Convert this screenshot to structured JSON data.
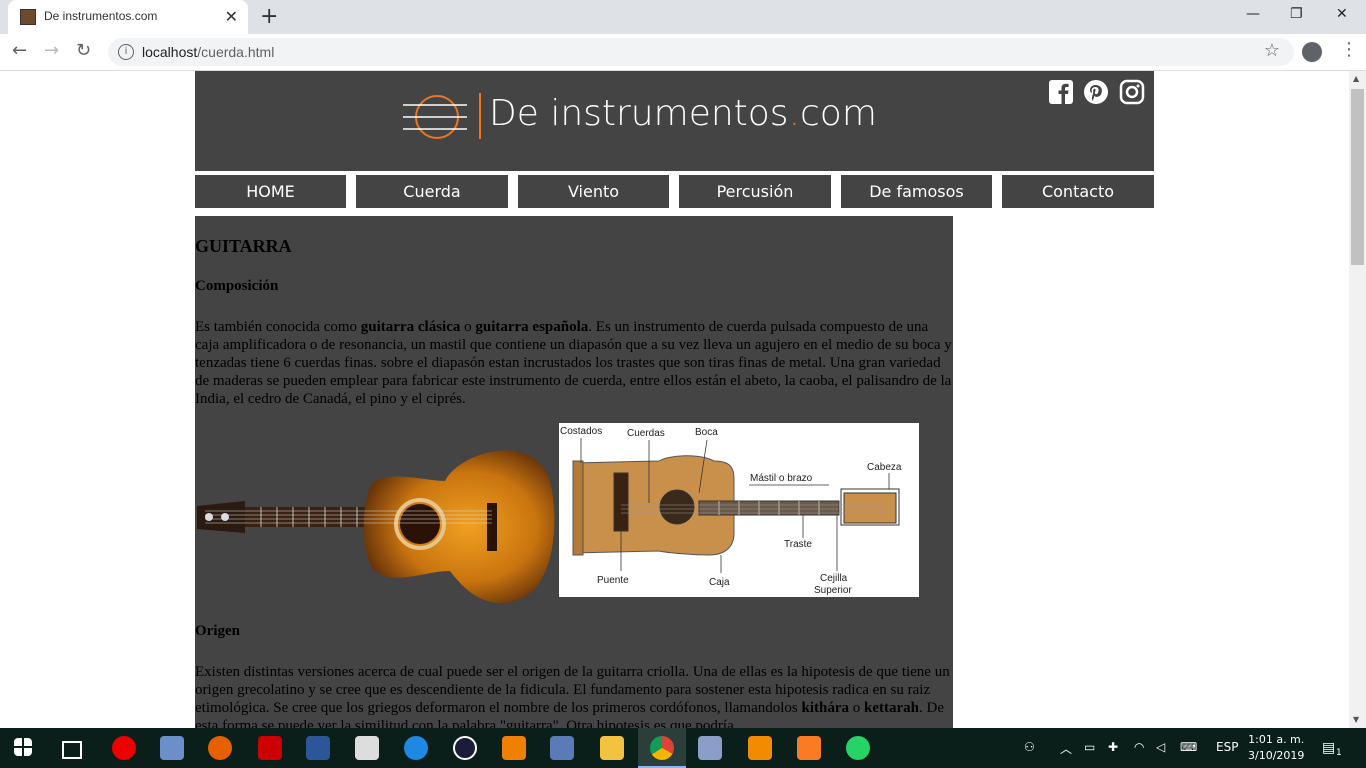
{
  "browser": {
    "tab_title": "De instrumentos.com",
    "tab_close": "✕",
    "new_tab": "+",
    "url_host": "localhost",
    "url_path": "/cuerda.html",
    "window_controls": [
      "—",
      "❐",
      "✕"
    ]
  },
  "site": {
    "logo_main": "De instrumentos",
    "logo_dot": ".",
    "logo_tld": "com",
    "social_icons": [
      "facebook-icon",
      "pinterest-icon",
      "instagram-icon"
    ],
    "nav": [
      "HOME",
      "Cuerda",
      "Viento",
      "Percusión",
      "De famosos",
      "Contacto"
    ]
  },
  "content": {
    "title": "GUITARRA",
    "composicion_heading": "Composición",
    "composicion_p1_a": "Es también conocida como ",
    "composicion_p1_b": "guitarra clásica",
    "composicion_p1_c": " o ",
    "composicion_p1_d": "guitarra española",
    "composicion_p1_e": ". Es un instrumento de cuerda pulsada compuesto de una caja amplificadora o de resonancia, un mastil que contiene un diapasón que a su vez lleva un agujero en el medio de su boca y tenzadas tiene 6 cuerdas finas. sobre el diapasón estan incrustados los trastes que son tiras finas de metal. Una gran variedad de maderas se pueden emplear para fabricar este instrumento de cuerda, entre ellos están el abeto, la caoba, el palisandro de la India, el cedro de Canadá, el pino y el ciprés.",
    "diagram_labels": {
      "costados": "Costados",
      "cuerdas": "Cuerdas",
      "boca": "Boca",
      "mastil": "Mástil o brazo",
      "cabeza": "Cabeza",
      "traste": "Traste",
      "puente": "Puente",
      "caja": "Caja",
      "cejilla1": "Cejilla",
      "cejilla2": "Superior"
    },
    "origen_heading": "Origen",
    "origen_p_a": "Existen distintas versiones acerca de cual puede ser el origen de la guitarra criolla. Una de ellas es la hipotesis de que tiene un origen grecolatino y se cree que es descendiente de la fidicula. El fundamento para sostener esta hipotesis radica en su raiz etimológica. Se cree que los griegos deformaron el nombre de los primeros cordófonos, llamandolos ",
    "origen_p_b": "kithára",
    "origen_p_c": " o ",
    "origen_p_d": "kettarah",
    "origen_p_e": ". De esta forma se puede ver la similitud con la palabra \"guitarra\". Otra hipotesis es que podría"
  },
  "taskbar": {
    "lang": "ESP",
    "time": "1:01 a. m.",
    "date": "3/10/2019",
    "notif_count": "1"
  },
  "colors": {
    "header_bg": "#444444",
    "accent": "#e87722",
    "taskbar_bg": "#0b1f1a"
  }
}
